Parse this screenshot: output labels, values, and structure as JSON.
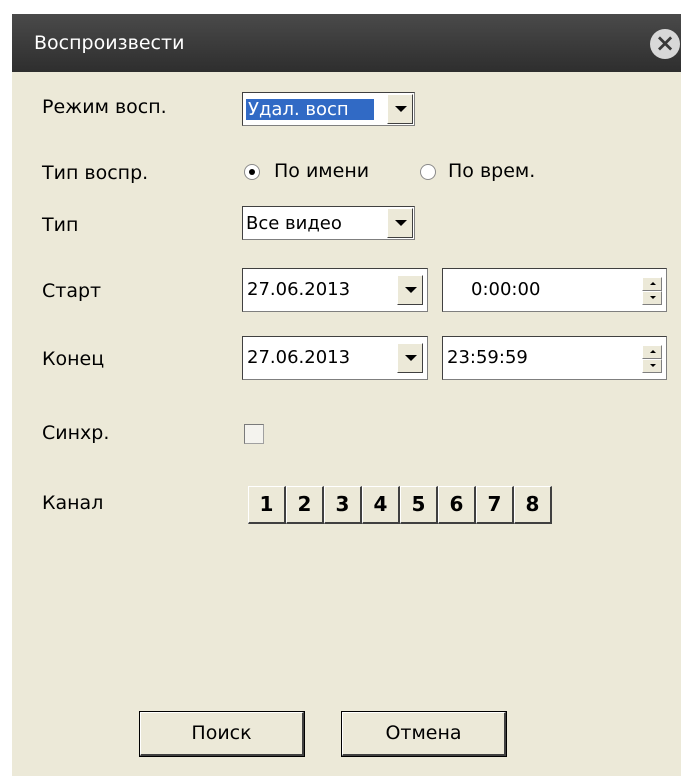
{
  "window": {
    "title": "Воспроизвести",
    "close_icon": "×"
  },
  "form": {
    "mode": {
      "label": "Режим восп.",
      "value": "Удал. восп"
    },
    "play_type": {
      "label": "Тип воспр.",
      "options": [
        "По имени",
        "По врем."
      ],
      "selected": "По имени"
    },
    "type": {
      "label": "Тип",
      "value": "Все видео"
    },
    "start": {
      "label": "Старт",
      "date": "27.06.2013",
      "time": "0:00:00"
    },
    "end": {
      "label": "Конец",
      "date": "27.06.2013",
      "time": "23:59:59"
    },
    "sync": {
      "label": "Синхр.",
      "checked": false
    },
    "channel": {
      "label": "Канал",
      "buttons": [
        "1",
        "2",
        "3",
        "4",
        "5",
        "6",
        "7",
        "8"
      ]
    }
  },
  "buttons": {
    "search": "Поиск",
    "cancel": "Отмена"
  },
  "colors": {
    "dialog_bg": "#ece9d8",
    "titlebar": "#333333",
    "selection": "#316ac5"
  }
}
